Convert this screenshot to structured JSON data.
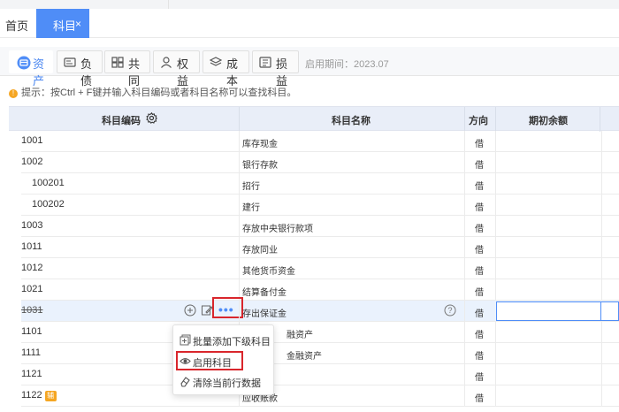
{
  "tabs": {
    "home": "首页",
    "active": "科目",
    "close": "×"
  },
  "categories": [
    {
      "label": "资产",
      "icon": "asset-icon",
      "active": true
    },
    {
      "label": "负债",
      "icon": "liability-icon",
      "active": false
    },
    {
      "label": "共同",
      "icon": "common-icon",
      "active": false
    },
    {
      "label": "权益",
      "icon": "equity-icon",
      "active": false
    },
    {
      "label": "成本",
      "icon": "cost-icon",
      "active": false
    },
    {
      "label": "损益",
      "icon": "profit-loss-icon",
      "active": false
    }
  ],
  "period": "启用期间：2023.07",
  "tip": "提示：按Ctrl + F键并输入科目编码或者科目名称可以查找科目。",
  "tip_icon": "!",
  "table": {
    "headers": {
      "code": "科目编码",
      "name": "科目名称",
      "direction": "方向",
      "opening": "期初余额"
    },
    "rows": [
      {
        "code": "1001",
        "name": "库存现金",
        "dir": "借"
      },
      {
        "code": "1002",
        "name": "银行存款",
        "dir": "借"
      },
      {
        "code": "100201",
        "name": "招行",
        "dir": "借"
      },
      {
        "code": "100202",
        "name": "建行",
        "dir": "借"
      },
      {
        "code": "1003",
        "name": "存放中央银行款项",
        "dir": "借"
      },
      {
        "code": "1011",
        "name": "存放同业",
        "dir": "借"
      },
      {
        "code": "1012",
        "name": "其他货币资金",
        "dir": "借"
      },
      {
        "code": "1021",
        "name": "结算备付金",
        "dir": "借"
      },
      {
        "code": "1031",
        "name": "存出保证金",
        "dir": "借"
      },
      {
        "code": "1101",
        "name": "融资产",
        "dir": "借"
      },
      {
        "code": "1111",
        "name": "金融资产",
        "dir": "借"
      },
      {
        "code": "1121",
        "name": "",
        "dir": "借"
      },
      {
        "code": "1122",
        "name": "应收账款",
        "dir": "借",
        "badge": "辅"
      }
    ]
  },
  "more_button": "•••",
  "context_menu": {
    "batch_add": "批量添加下级科目",
    "enable": "启用科目",
    "clear_row": "清除当前行数据"
  },
  "colors": {
    "accent": "#4f8df7",
    "highlight_box": "#d9262c",
    "badge": "#f5a623"
  }
}
